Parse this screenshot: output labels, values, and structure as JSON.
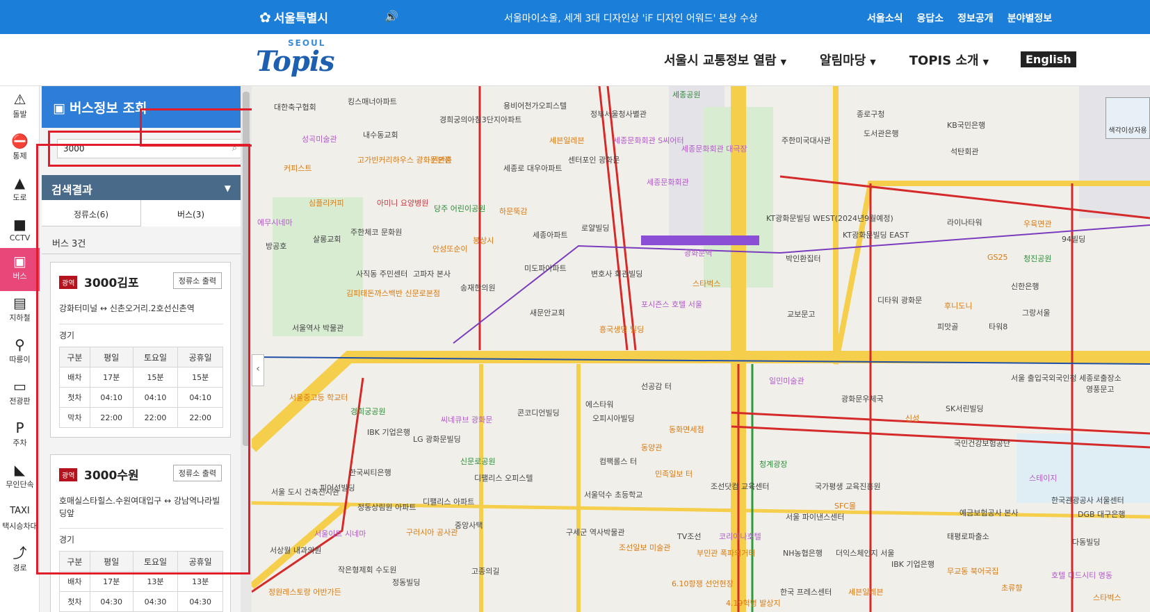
{
  "topbar": {
    "city": "서울특별시",
    "news": "서울마이소울, 세계 3대 디자인상 'iF 디자인 어워드' 본상 수상",
    "links": [
      "서울소식",
      "응답소",
      "정보공개",
      "분야별정보"
    ]
  },
  "header": {
    "brand_small": "SEOUL",
    "brand_big": "Topis",
    "nav": [
      "서울시 교통정보 열람",
      "알림마당",
      "TOPIS 소개"
    ],
    "english": "English"
  },
  "rail": [
    {
      "label": "돌발",
      "icon": "alert-icon"
    },
    {
      "label": "통제",
      "icon": "no-entry-icon"
    },
    {
      "label": "도로",
      "icon": "road-icon"
    },
    {
      "label": "CCTV",
      "icon": "camera-icon"
    },
    {
      "label": "버스",
      "icon": "bus-icon",
      "active": true
    },
    {
      "label": "지하철",
      "icon": "subway-icon"
    },
    {
      "label": "따릉이",
      "icon": "bike-icon"
    },
    {
      "label": "전광판",
      "icon": "display-icon"
    },
    {
      "label": "주차",
      "icon": "parking-icon"
    },
    {
      "label": "무인단속",
      "icon": "speed-camera-icon"
    },
    {
      "label": "택시승차대",
      "icon": "taxi-icon"
    },
    {
      "label": "경로",
      "icon": "route-icon"
    }
  ],
  "panel": {
    "title": "버스정보 조회",
    "search_value": "3000",
    "result_header": "검색결과",
    "tabs": [
      "정류소(6)",
      "버스(3)"
    ],
    "count": "버스 3건",
    "routes": [
      {
        "badge": "광역",
        "name": "3000김포",
        "button": "정류소 출력",
        "path": "강화터미널 ↔ 신촌오거리.2호선신촌역",
        "region": "경기",
        "headers": [
          "구분",
          "평일",
          "토요일",
          "공휴일"
        ],
        "rows": [
          [
            "배차",
            "17분",
            "15분",
            "15분"
          ],
          [
            "첫차",
            "04:10",
            "04:10",
            "04:10"
          ],
          [
            "막차",
            "22:00",
            "22:00",
            "22:00"
          ]
        ]
      },
      {
        "badge": "광역",
        "name": "3000수원",
        "button": "정류소 출력",
        "path": "호매실스타힐스.수원여대입구 ↔ 강남역나라빌딩앞",
        "region": "경기",
        "headers": [
          "구분",
          "평일",
          "토요일",
          "공휴일"
        ],
        "rows": [
          [
            "배차",
            "17분",
            "13분",
            "13분"
          ],
          [
            "첫차",
            "04:30",
            "04:30",
            "04:30"
          ]
        ]
      }
    ]
  },
  "map": {
    "labels": [
      {
        "t": "대한축구협회",
        "c": ""
      },
      {
        "t": "킹스매너아파트",
        "c": ""
      },
      {
        "t": "경희궁의아침3단지아파트",
        "c": ""
      },
      {
        "t": "용비어천가오피스텔",
        "c": ""
      },
      {
        "t": "정부서울청사별관",
        "c": ""
      },
      {
        "t": "세종공원",
        "c": "g"
      },
      {
        "t": "종로구청",
        "c": ""
      },
      {
        "t": "KB국민은행",
        "c": ""
      },
      {
        "t": "성곡미술관",
        "c": "p"
      },
      {
        "t": "내수동교회",
        "c": ""
      },
      {
        "t": "세븐일레븐",
        "c": "o"
      },
      {
        "t": "세종문화회관 S씨어터",
        "c": "p"
      },
      {
        "t": "세종문화회관 대극장",
        "c": "p"
      },
      {
        "t": "주한미국대사관",
        "c": ""
      },
      {
        "t": "도서관은행",
        "c": ""
      },
      {
        "t": "석탄회관",
        "c": ""
      },
      {
        "t": "커피스트",
        "c": "o"
      },
      {
        "t": "고가빈커리하우스 광화문본점",
        "c": "o"
      },
      {
        "t": "신안촌",
        "c": "o"
      },
      {
        "t": "세종로 대우아파트",
        "c": ""
      },
      {
        "t": "센터포인 광화문",
        "c": ""
      },
      {
        "t": "세종문화회관",
        "c": "p"
      },
      {
        "t": "청진공원",
        "c": "g"
      },
      {
        "t": "심플리커피",
        "c": "o"
      },
      {
        "t": "아미니 요양병원",
        "c": "r"
      },
      {
        "t": "당주 어린이공원",
        "c": "g"
      },
      {
        "t": "KT광화문빌딩 WEST(2024년9월예정)",
        "c": ""
      },
      {
        "t": "라이나타워",
        "c": ""
      },
      {
        "t": "우육면관",
        "c": "o"
      },
      {
        "t": "에무시네마",
        "c": "p"
      },
      {
        "t": "살롱교회",
        "c": ""
      },
      {
        "t": "주한체코 문화원",
        "c": ""
      },
      {
        "t": "하문뚝감",
        "c": "o"
      },
      {
        "t": "세종아파트",
        "c": ""
      },
      {
        "t": "로얄빌딩",
        "c": ""
      },
      {
        "t": "KT광화문빌딩 EAST",
        "c": ""
      },
      {
        "t": "94빌딩",
        "c": ""
      },
      {
        "t": "방공호",
        "c": ""
      },
      {
        "t": "안성또순이",
        "c": "o"
      },
      {
        "t": "봉상시",
        "c": "o"
      },
      {
        "t": "광화문역",
        "c": "p"
      },
      {
        "t": "박인환집터",
        "c": ""
      },
      {
        "t": "GS25",
        "c": "o"
      },
      {
        "t": "사직동 주민센터",
        "c": ""
      },
      {
        "t": "고파자 본사",
        "c": ""
      },
      {
        "t": "미도파아파트",
        "c": ""
      },
      {
        "t": "변호사 회관빌딩",
        "c": ""
      },
      {
        "t": "스타벅스",
        "c": "o"
      },
      {
        "t": "신한은행",
        "c": ""
      },
      {
        "t": "김피태돈까스백반 신문로본점",
        "c": "o"
      },
      {
        "t": "송재한의원",
        "c": ""
      },
      {
        "t": "새문안교회",
        "c": ""
      },
      {
        "t": "포시즌스 호텔 서울",
        "c": "p"
      },
      {
        "t": "교보문고",
        "c": ""
      },
      {
        "t": "디타워 광화문",
        "c": ""
      },
      {
        "t": "후니도니",
        "c": "o"
      },
      {
        "t": "그랑서울",
        "c": ""
      },
      {
        "t": "서울역사 박물관",
        "c": ""
      },
      {
        "t": "흥국생명 빌딩",
        "c": "o"
      },
      {
        "t": "피맛골",
        "c": ""
      },
      {
        "t": "타워8",
        "c": ""
      },
      {
        "t": "서울중고등 학교터",
        "c": "o"
      },
      {
        "t": "경희궁공원",
        "c": "g"
      },
      {
        "t": "선공감 터",
        "c": ""
      },
      {
        "t": "콘코디언빌딩",
        "c": ""
      },
      {
        "t": "에스타워",
        "c": ""
      },
      {
        "t": "일민미술관",
        "c": "p"
      },
      {
        "t": "광화문우체국",
        "c": ""
      },
      {
        "t": "SK서린빌딩",
        "c": ""
      },
      {
        "t": "서울 출입국외국인청 세종로출장소",
        "c": ""
      },
      {
        "t": "영풍문고",
        "c": ""
      },
      {
        "t": "씨네큐브 광화문",
        "c": "p"
      },
      {
        "t": "오피시아빌딩",
        "c": ""
      },
      {
        "t": "동화면세점",
        "c": "o"
      },
      {
        "t": "신성",
        "c": "o"
      },
      {
        "t": "IBK 기업은행",
        "c": ""
      },
      {
        "t": "LG 광화문빌딩",
        "c": ""
      },
      {
        "t": "신문로공원",
        "c": "g"
      },
      {
        "t": "동양관",
        "c": "o"
      },
      {
        "t": "청계광장",
        "c": "g"
      },
      {
        "t": "국민건강보험공단",
        "c": ""
      },
      {
        "t": "한국씨티은행",
        "c": ""
      },
      {
        "t": "디팰리스 오피스텔",
        "c": ""
      },
      {
        "t": "컴팩롤스 터",
        "c": ""
      },
      {
        "t": "민족일보 터",
        "c": "o"
      },
      {
        "t": "조선닷컴 교육센터",
        "c": ""
      },
      {
        "t": "국가평생 교육진흥원",
        "c": ""
      },
      {
        "t": "스테이지",
        "c": "p"
      },
      {
        "t": "서울 도시 건축전시관",
        "c": ""
      },
      {
        "t": "피어선빌딩",
        "c": ""
      },
      {
        "t": "서울덕수 초등학교",
        "c": ""
      },
      {
        "t": "SFC몰",
        "c": "o"
      },
      {
        "t": "서울 파이낸스센터",
        "c": ""
      },
      {
        "t": "한국관광공사 서울센터",
        "c": ""
      },
      {
        "t": "정동상림원 아파트",
        "c": ""
      },
      {
        "t": "디팰리스 아파트",
        "c": ""
      },
      {
        "t": "구러시아 공사관",
        "c": "o"
      },
      {
        "t": "중앙사택",
        "c": ""
      },
      {
        "t": "구세군 역사박물관",
        "c": ""
      },
      {
        "t": "TV조선",
        "c": ""
      },
      {
        "t": "코리아나호텔",
        "c": "p"
      },
      {
        "t": "서울이트 시네마",
        "c": "p"
      },
      {
        "t": "서상월 내과의원",
        "c": ""
      },
      {
        "t": "작은형제회 수도원",
        "c": ""
      },
      {
        "t": "정동빌딩",
        "c": ""
      },
      {
        "t": "고종의길",
        "c": ""
      },
      {
        "t": "조선일보 미술관",
        "c": "o"
      },
      {
        "t": "부민관 폭파의거터",
        "c": "o"
      },
      {
        "t": "NH농협은행",
        "c": ""
      },
      {
        "t": "더익스체인지 서울",
        "c": ""
      },
      {
        "t": "IBK 기업은행",
        "c": ""
      },
      {
        "t": "무교동 북어국집",
        "c": "o"
      },
      {
        "t": "초류향",
        "c": "o"
      },
      {
        "t": "호텔 미드시티 명동",
        "c": "p"
      },
      {
        "t": "정원레스토랑 어반가든",
        "c": "o"
      },
      {
        "t": "6.10항쟁 선언현장",
        "c": "o"
      },
      {
        "t": "4.19혁명 발상지",
        "c": "o"
      },
      {
        "t": "한국 프레스센터",
        "c": ""
      },
      {
        "t": "세븐일레븐",
        "c": "o"
      },
      {
        "t": "예금보험공사 본사",
        "c": ""
      },
      {
        "t": "DGB 대구은행",
        "c": ""
      },
      {
        "t": "다동빌딩",
        "c": ""
      },
      {
        "t": "태평로파출소",
        "c": ""
      },
      {
        "t": "스타벅스",
        "c": "o"
      }
    ],
    "minimap_label": "색각이상자용"
  }
}
